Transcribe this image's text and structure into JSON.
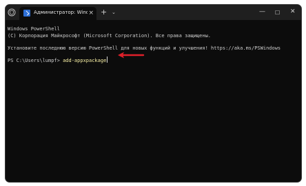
{
  "tab": {
    "title": "Администратор: Windows Pc",
    "close": "×"
  },
  "titlebar": {
    "new_tab": "+",
    "dropdown": "⌄",
    "minimize": "—",
    "maximize": "☐",
    "close": "✕"
  },
  "console": {
    "line1": "Windows PowerShell",
    "line2": "(C) Корпорация Майкрософт (Microsoft Corporation). Все права защищены.",
    "line3": "Установите последнюю версию PowerShell для новых функций и улучшения! https://aka.ms/PSWindows",
    "prompt": "PS C:\\Users\\lumpf> ",
    "command": "add-appxpackage"
  },
  "colors": {
    "background": "#0c0c0c",
    "text": "#cccccc",
    "command": "#f9f1a5",
    "arrow": "#e0202a"
  },
  "icons": [
    "shield-icon",
    "powershell-tab-icon",
    "annotation-arrow-icon"
  ]
}
